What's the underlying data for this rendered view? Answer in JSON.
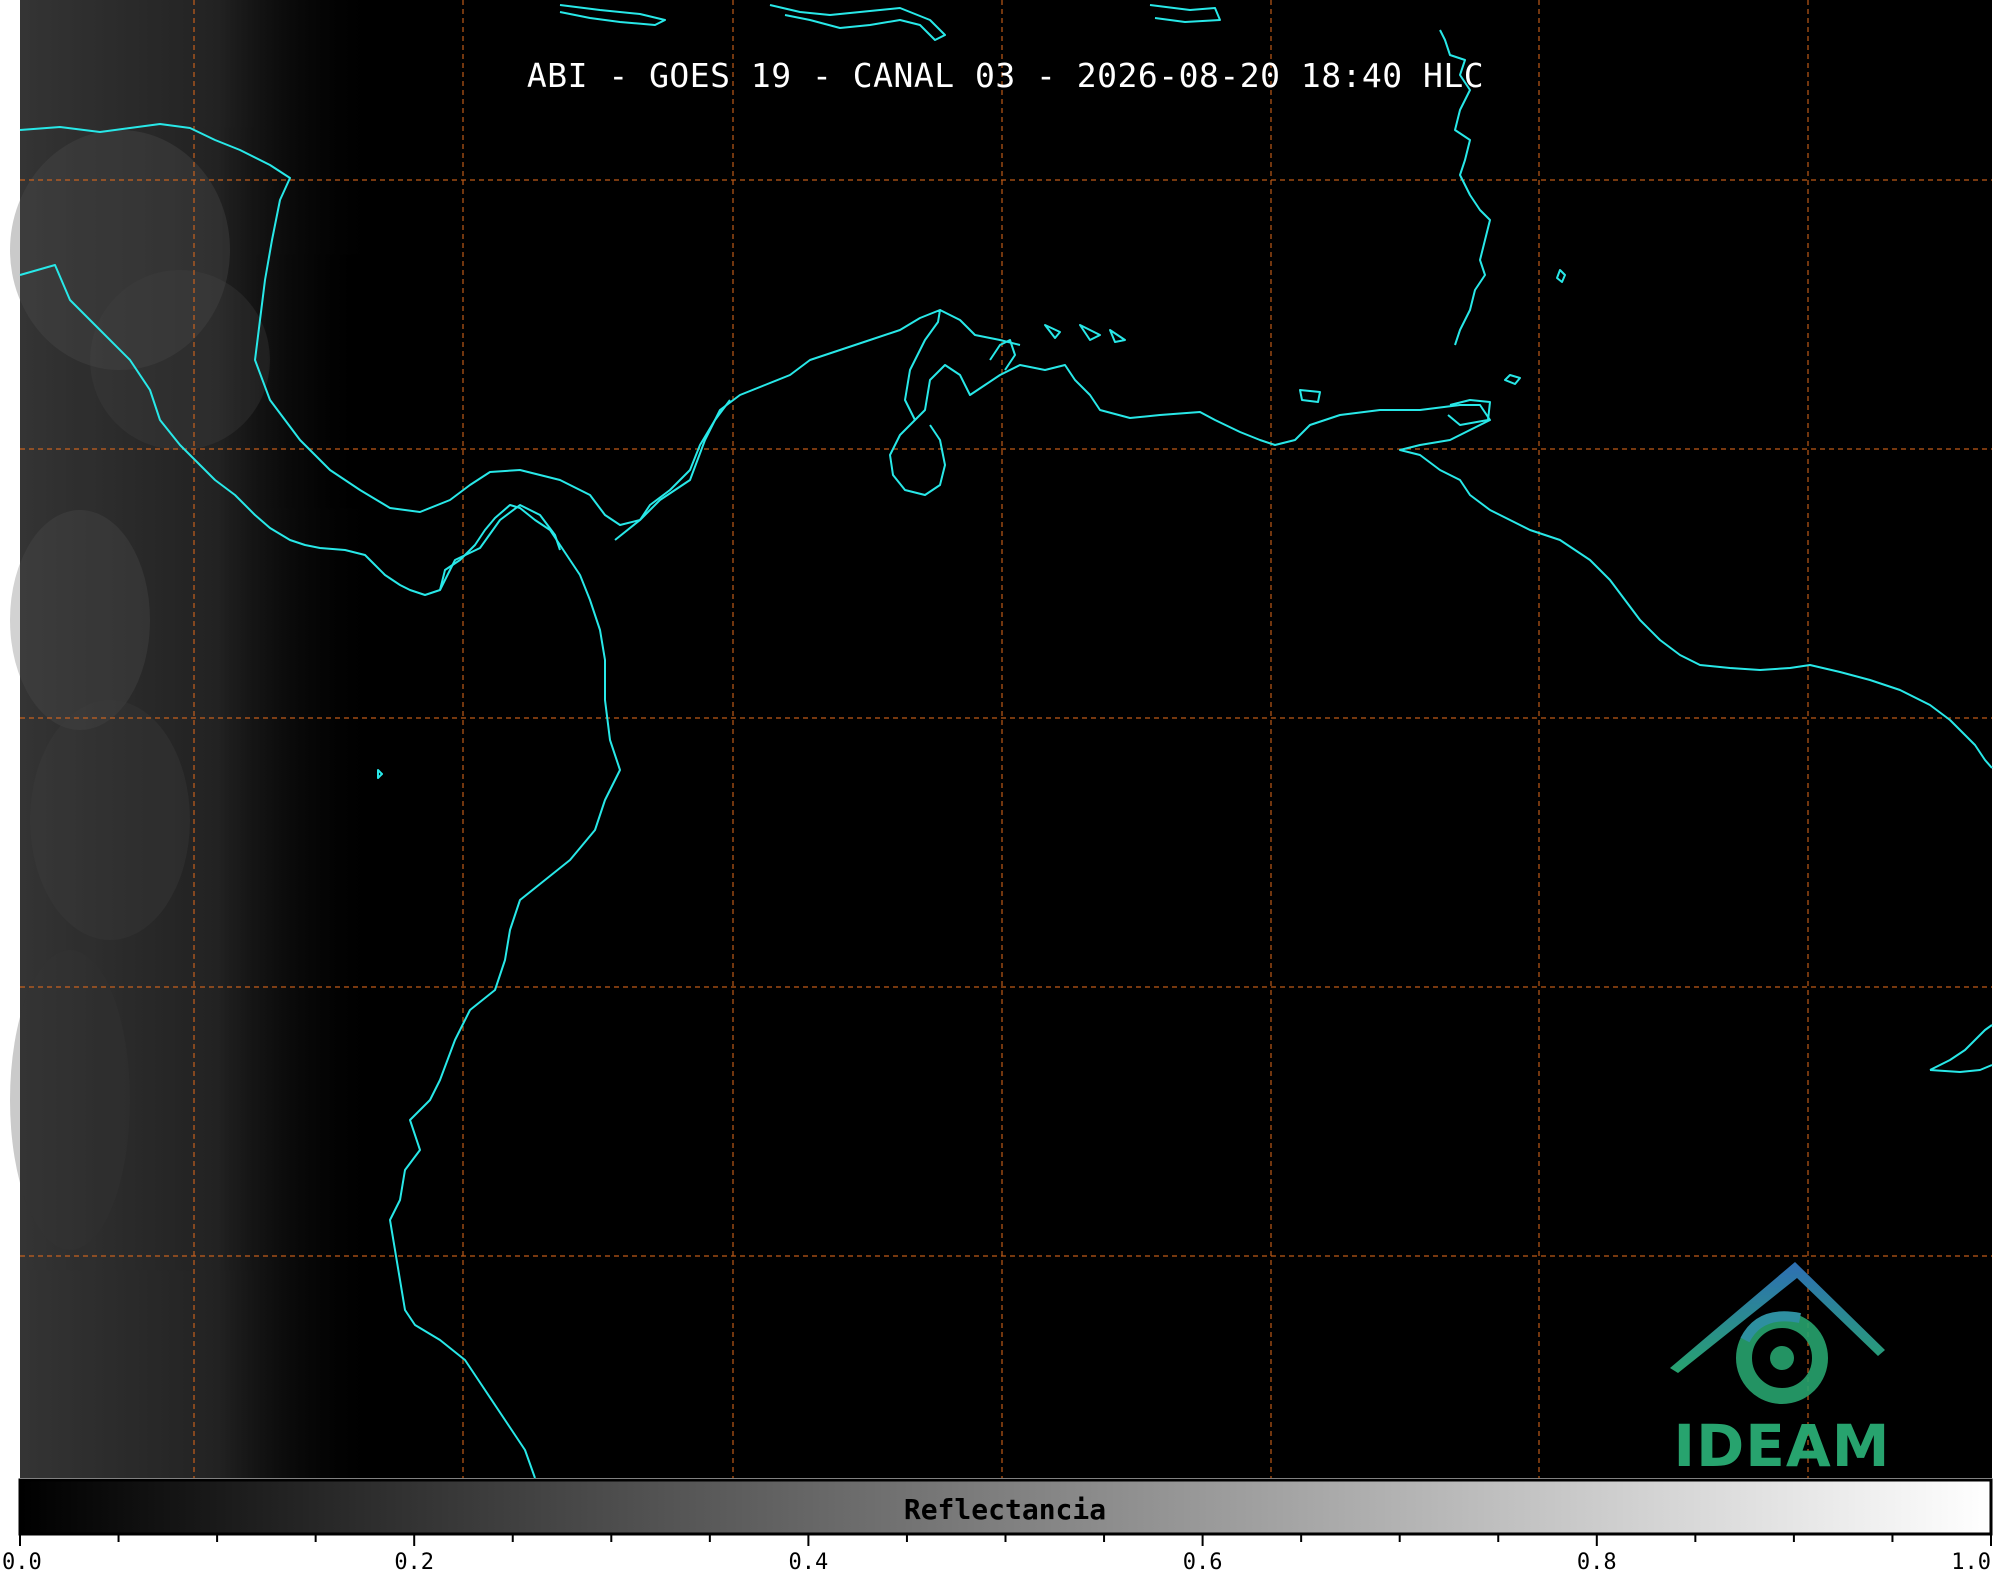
{
  "title": "ABI - GOES 19 - CANAL 03 - 2026-08-20 18:40 HLC",
  "colorbar": {
    "label": "Reflectancia",
    "min": 0.0,
    "max": 1.0,
    "ticks": [
      "0.0",
      "0.2",
      "0.4",
      "0.6",
      "0.8",
      "1.0"
    ],
    "colormap": [
      "#000000",
      "#ffffff"
    ]
  },
  "logo": {
    "name": "ideam-logo",
    "text": "IDEAM"
  },
  "colors": {
    "background": "#000000",
    "coastline": "#28e8e8",
    "gridline": "#e06a1c",
    "logo_green": "#27a36e",
    "logo_blue": "#2e6fb5"
  },
  "gridlines": {
    "style": "dashed",
    "vertical_count": 7,
    "horizontal_count": 5
  },
  "coastline_icon": "cyan-outline"
}
